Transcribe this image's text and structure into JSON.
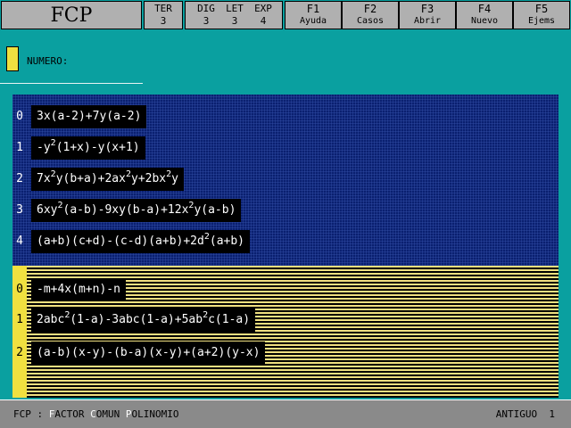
{
  "app": {
    "title": "FCP"
  },
  "stats": [
    {
      "label": "TER",
      "value": "3"
    },
    {
      "label": "DIG",
      "value": "3"
    },
    {
      "label": "LET",
      "value": "3"
    },
    {
      "label": "EXP",
      "value": "4"
    }
  ],
  "fkeys": [
    {
      "key": "F1",
      "label": "Ayuda"
    },
    {
      "key": "F2",
      "label": "Casos"
    },
    {
      "key": "F3",
      "label": "Abrir"
    },
    {
      "key": "F4",
      "label": "Nuevo"
    },
    {
      "key": "F5",
      "label": "Ejems"
    }
  ],
  "numero_label": "NUMERO:",
  "panel_top": [
    {
      "index": "0",
      "expr": "3x(a-2)+7y(a-2)"
    },
    {
      "index": "1",
      "expr": "-y^2(1+x)-y(x+1)"
    },
    {
      "index": "2",
      "expr": "7x^2y(b+a)+2ax^2y+2bx^2y"
    },
    {
      "index": "3",
      "expr": "6xy^2(a-b)-9xy(b-a)+12x^2y(a-b)"
    },
    {
      "index": "4",
      "expr": "(a+b)(c+d)-(c-d)(a+b)+2d^2(a+b)"
    }
  ],
  "panel_bottom": [
    {
      "index": "0",
      "expr": "-m+4x(m+n)-n"
    },
    {
      "index": "1",
      "expr": "2abc^2(1-a)-3abc(1-a)+5ab^2c(1-a)"
    },
    {
      "index": "2",
      "expr": "(a-b)(x-y)-(b-a)(x-y)+(a+2)(y-x)"
    }
  ],
  "status": {
    "prefix": "FCP : ",
    "words": [
      {
        "initial": "F",
        "rest": "ACTOR "
      },
      {
        "initial": "C",
        "rest": "OMUN "
      },
      {
        "initial": "P",
        "rest": "OLINOMIO"
      }
    ],
    "right_label": "ANTIGUO",
    "right_value": "1"
  },
  "colors": {
    "background": "#0aa0a0",
    "blue_panel": "#0a2070",
    "yellow": "#f0e040",
    "bar": "#b0b0b0"
  }
}
